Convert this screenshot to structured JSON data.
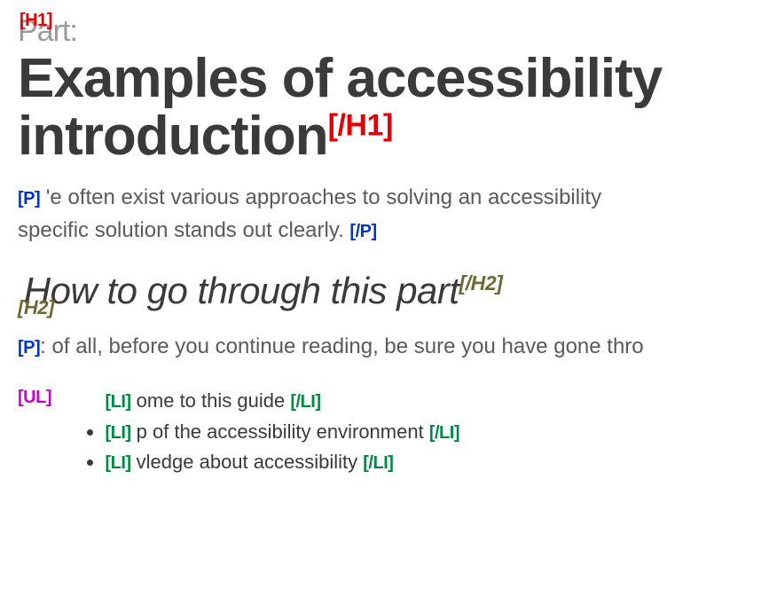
{
  "tags": {
    "h1_open": "[H1]",
    "h1_close": "[/H1]",
    "h2_open": "[H2]",
    "h2_close": "[/H2]",
    "p_open": "[P]",
    "p_close": "[/P]",
    "ul_open": "[UL]",
    "li_open": "[LI]",
    "li_close": "[/LI]"
  },
  "heading1": {
    "part_label": "Part:",
    "line1": "Examples of accessibility",
    "line2": "introduction"
  },
  "para1": {
    "frag1": "'e often exist various approaches to solving an accessibility",
    "frag2": "specific solution stands out clearly."
  },
  "heading2": "How to go through this part",
  "para2": ": of all, before you continue reading, be sure you have gone thro",
  "list": {
    "item1": "ome to this guide",
    "item2": "p of the accessibility environment",
    "item3": "vledge about accessibility"
  }
}
